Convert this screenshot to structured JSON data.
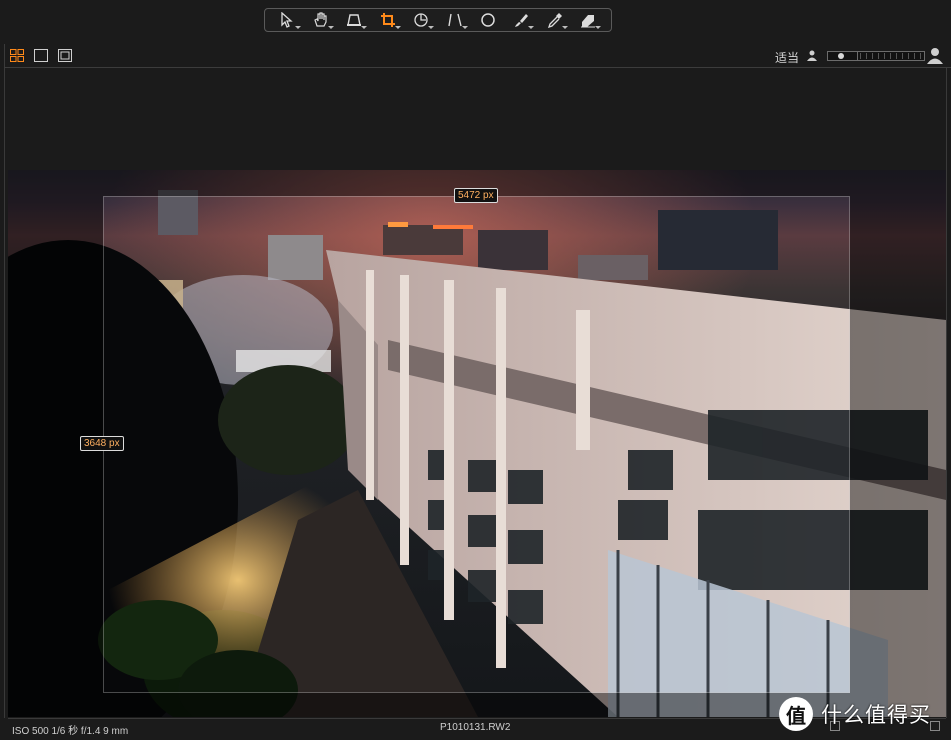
{
  "toolbar": {
    "tools": [
      {
        "icon": "select-arrow-icon",
        "active": false
      },
      {
        "icon": "hand-pan-icon",
        "active": false
      },
      {
        "icon": "keystone-icon",
        "active": false
      },
      {
        "icon": "crop-icon",
        "active": true
      },
      {
        "icon": "rotate-icon",
        "active": false
      },
      {
        "icon": "straighten-icon",
        "active": false
      },
      {
        "icon": "circle-select-icon",
        "active": false
      },
      {
        "icon": "brush-icon",
        "active": false
      },
      {
        "icon": "eyedropper-icon",
        "active": false
      },
      {
        "icon": "eraser-icon",
        "active": false
      }
    ],
    "active_color": "#ff8a1a"
  },
  "viewer": {
    "fit_label": "适当",
    "zoom_level": 0.15
  },
  "crop": {
    "width_label": "5472 px",
    "height_label": "3648 px"
  },
  "status": {
    "exposure": "ISO 500  1/6 秒  f/1.4  9 mm",
    "filename": "P1010131.RW2"
  },
  "watermark": {
    "logo_glyph": "值",
    "text": "什么值得买"
  }
}
